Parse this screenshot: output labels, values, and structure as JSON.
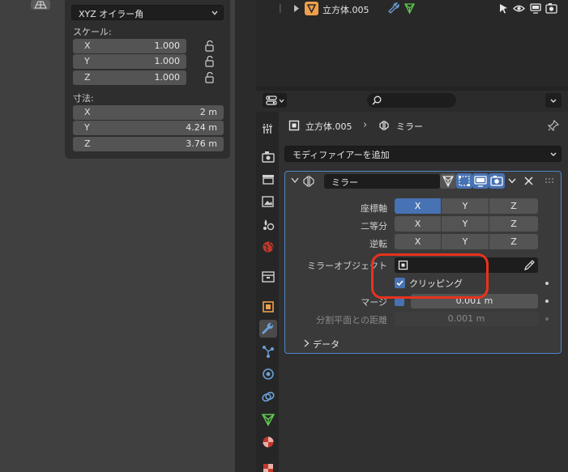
{
  "left_panel": {
    "rotation_mode": "XYZ オイラー角",
    "scale_label": "スケール:",
    "scale": [
      {
        "axis": "X",
        "value": "1.000"
      },
      {
        "axis": "Y",
        "value": "1.000"
      },
      {
        "axis": "Z",
        "value": "1.000"
      }
    ],
    "dimensions_label": "寸法:",
    "dimensions": [
      {
        "axis": "X",
        "value": "2 m"
      },
      {
        "axis": "Y",
        "value": "4.24 m"
      },
      {
        "axis": "Z",
        "value": "3.76 m"
      }
    ]
  },
  "outliner": {
    "object_name": "立方体.005"
  },
  "properties": {
    "breadcrumb": {
      "object": "立方体.005",
      "separator": "›",
      "modifier": "ミラー"
    },
    "add_modifier": "モディファイアーを追加",
    "modifier": {
      "name": "ミラー",
      "axis_label": "座標軸",
      "bisect_label": "二等分",
      "flip_label": "逆転",
      "axes": [
        "X",
        "Y",
        "Z"
      ],
      "axis_active": "X",
      "mirror_object_label": "ミラーオブジェクト",
      "clipping_label": "クリッピング",
      "clipping_checked": true,
      "merge_label": "マージ",
      "merge_value": "0.001 m",
      "bisect_distance_label": "分割平面との距離",
      "bisect_distance_value": "0.001 m",
      "data_label": "データ"
    }
  },
  "colors": {
    "accent_blue": "#4772b3",
    "annotation_red": "#e8321e",
    "object_orange": "#f0a04b",
    "modifier_blue": "#6a9fd8",
    "mesh_green": "#5fc74f"
  }
}
